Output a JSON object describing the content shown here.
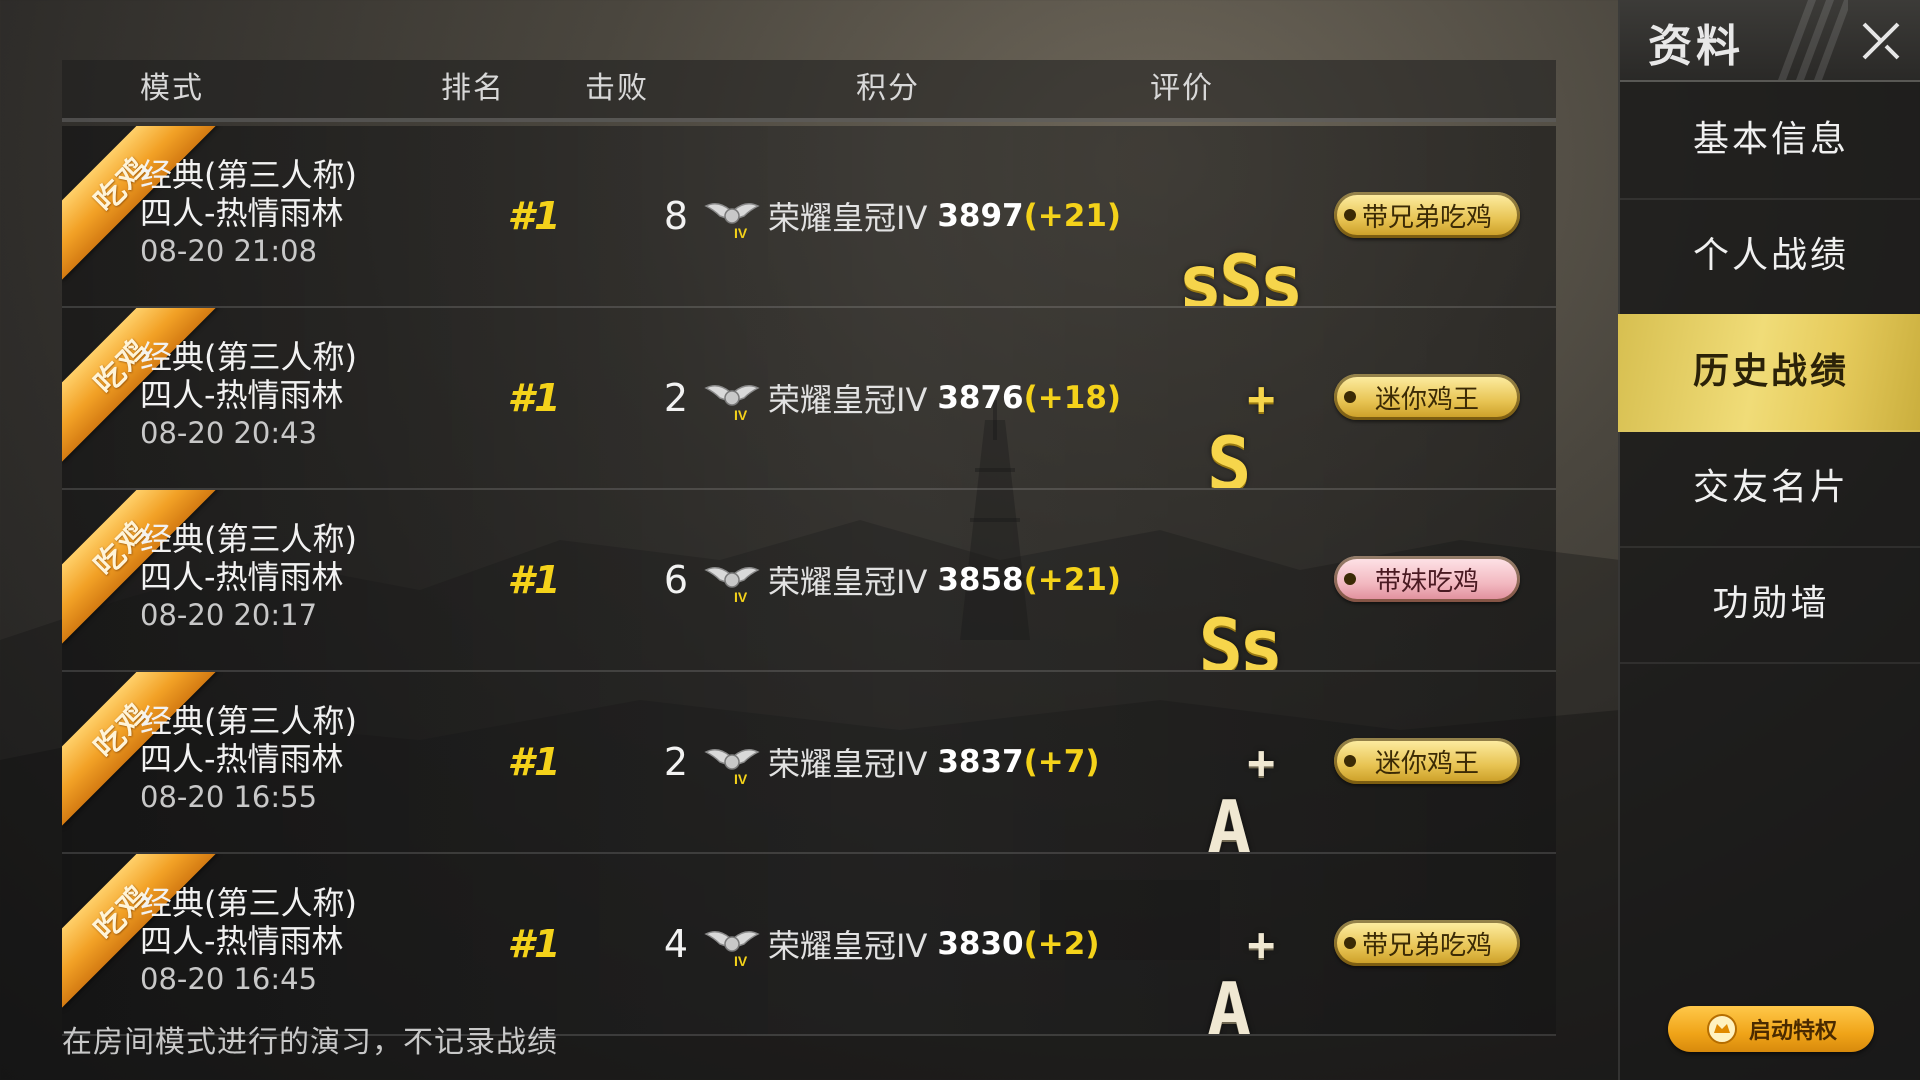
{
  "columns": {
    "mode": "模式",
    "rank": "排名",
    "kills": "击败",
    "score": "积分",
    "rating": "评价"
  },
  "ribbon_label": "吃鸡",
  "matches": [
    {
      "mode": "经典(第三人称)",
      "map": "四人-热情雨林",
      "time": "08-20 21:08",
      "rank": "#1",
      "kills": "8",
      "tier": "荣耀皇冠IV",
      "score": "3897",
      "delta": "(+21)",
      "grade": "sSs",
      "grade_plus": "",
      "grade_color": "gold",
      "badge": "带兄弟吃鸡",
      "badge_color": "gold"
    },
    {
      "mode": "经典(第三人称)",
      "map": "四人-热情雨林",
      "time": "08-20 20:43",
      "rank": "#1",
      "kills": "2",
      "tier": "荣耀皇冠IV",
      "score": "3876",
      "delta": "(+18)",
      "grade": "S",
      "grade_plus": "+",
      "grade_color": "gold",
      "badge": "迷你鸡王",
      "badge_color": "gold"
    },
    {
      "mode": "经典(第三人称)",
      "map": "四人-热情雨林",
      "time": "08-20 20:17",
      "rank": "#1",
      "kills": "6",
      "tier": "荣耀皇冠IV",
      "score": "3858",
      "delta": "(+21)",
      "grade": "Ss",
      "grade_plus": "",
      "grade_color": "gold",
      "badge": "带妹吃鸡",
      "badge_color": "pink"
    },
    {
      "mode": "经典(第三人称)",
      "map": "四人-热情雨林",
      "time": "08-20 16:55",
      "rank": "#1",
      "kills": "2",
      "tier": "荣耀皇冠IV",
      "score": "3837",
      "delta": "(+7)",
      "grade": "A",
      "grade_plus": "+",
      "grade_color": "white",
      "badge": "迷你鸡王",
      "badge_color": "gold"
    },
    {
      "mode": "经典(第三人称)",
      "map": "四人-热情雨林",
      "time": "08-20 16:45",
      "rank": "#1",
      "kills": "4",
      "tier": "荣耀皇冠IV",
      "score": "3830",
      "delta": "(+2)",
      "grade": "A",
      "grade_plus": "+",
      "grade_color": "white",
      "badge": "带兄弟吃鸡",
      "badge_color": "gold"
    }
  ],
  "footnote": "在房间模式进行的演习，不记录战绩",
  "sidebar": {
    "title": "资料",
    "items": [
      {
        "label": "基本信息",
        "active": false
      },
      {
        "label": "个人战绩",
        "active": false
      },
      {
        "label": "历史战绩",
        "active": true
      },
      {
        "label": "交友名片",
        "active": false
      },
      {
        "label": "功勋墙",
        "active": false
      }
    ],
    "privilege_label": "启动特权"
  },
  "colors": {
    "accent_gold": "#f4d21a",
    "active_tab": "#e6cb5c",
    "ribbon": "#f2a126",
    "pink_badge": "#f2b8c0"
  },
  "icons": {
    "ribbon": "chicken-dinner-ribbon",
    "tier": "crown-wings-icon",
    "row_action": "chevron-right-icon",
    "close": "close-icon",
    "privilege": "privilege-icon"
  }
}
